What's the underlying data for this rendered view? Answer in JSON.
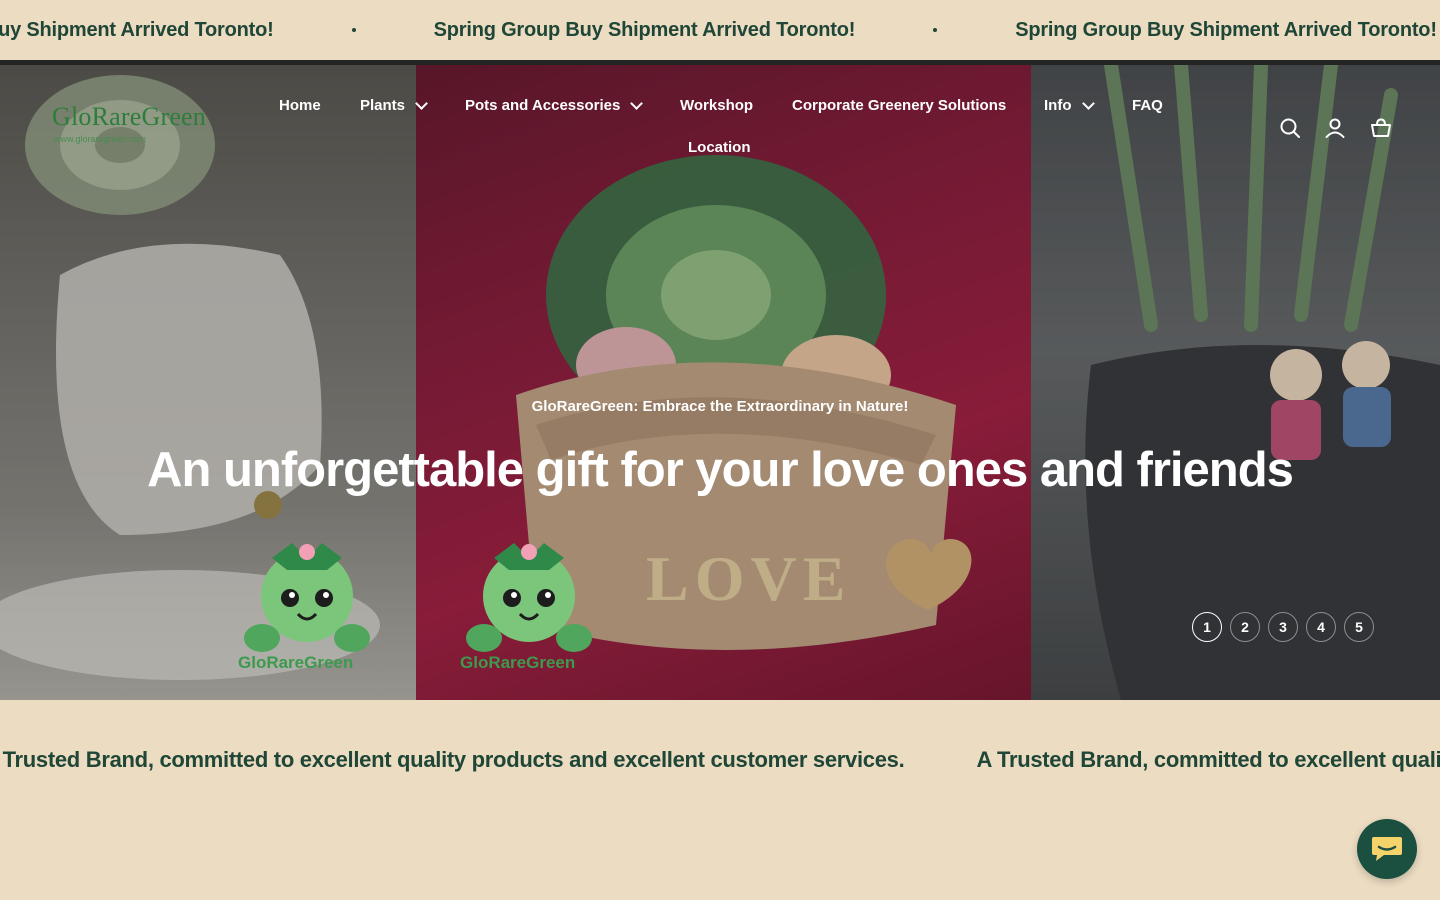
{
  "announcement": {
    "items": [
      "Spring Group Buy Shipment Arrived Toronto!",
      "Spring Group Buy Shipment Arrived Toronto!",
      "Spring Group Buy Shipment Arrived Toronto!"
    ]
  },
  "header": {
    "logo_text": "GloRareGreen",
    "logo_url": "www.gloraregreen.com",
    "nav": {
      "home": "Home",
      "plants": "Plants",
      "pots": "Pots and Accessories",
      "workshop": "Workshop",
      "corporate": "Corporate Greenery Solutions",
      "info": "Info",
      "faq": "FAQ",
      "location": "Location"
    },
    "icons": [
      "search-icon",
      "account-icon",
      "cart-icon"
    ]
  },
  "hero": {
    "subheading": "GloRareGreen: Embrace the Extraordinary in Nature!",
    "title": "An unforgettable gift for your love ones and friends",
    "pot_text": "LOVE",
    "sticker_label": "GloRareGreen",
    "slides": [
      "1",
      "2",
      "3",
      "4",
      "5"
    ],
    "active_slide": 1
  },
  "brand_marquee": {
    "items": [
      "A Trusted Brand, committed to excellent quality products and excellent customer services.",
      "A Trusted Brand, committed to excellent quality products and excellent customer services."
    ]
  },
  "colors": {
    "background": "#ecdcc2",
    "brand_green": "#1f4637",
    "chat_button": "#1b4f3f",
    "logo_green": "#2e7d3a"
  }
}
